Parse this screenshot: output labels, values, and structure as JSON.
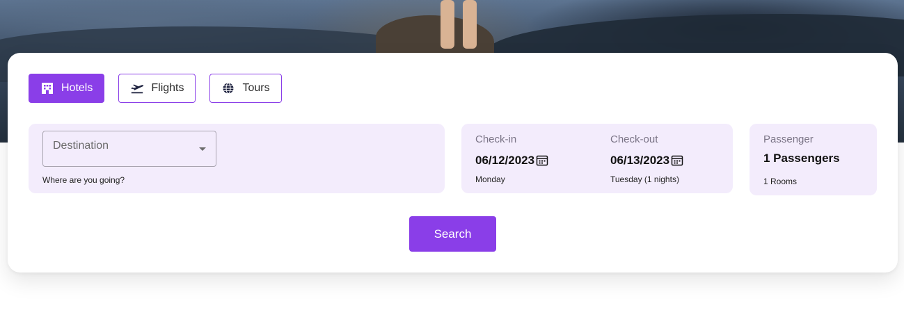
{
  "tabs": [
    {
      "label": "Hotels",
      "icon": "hotel-icon",
      "active": true
    },
    {
      "label": "Flights",
      "icon": "plane-icon",
      "active": false
    },
    {
      "label": "Tours",
      "icon": "globe-icon",
      "active": false
    }
  ],
  "destination": {
    "placeholder": "Destination",
    "hint": "Where are you going?"
  },
  "checkin": {
    "label": "Check-in",
    "date": "06/12/2023",
    "day": "Monday"
  },
  "checkout": {
    "label": "Check-out",
    "date": "06/13/2023",
    "day": "Tuesday (1 nights)"
  },
  "passenger": {
    "label": "Passenger",
    "value": "1 Passengers",
    "rooms": "1 Rooms"
  },
  "search": {
    "label": "Search"
  },
  "colors": {
    "accent": "#8a3ee8",
    "panel_bg": "#f3ecfc"
  }
}
